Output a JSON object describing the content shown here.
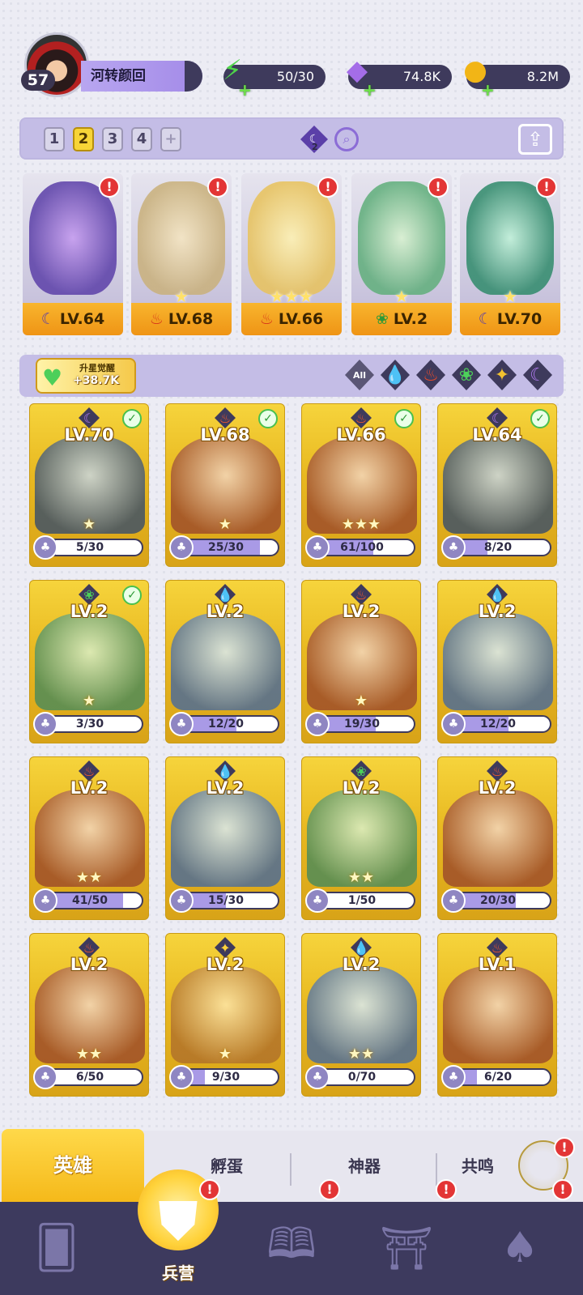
{
  "player": {
    "level": "57",
    "name": "河转颜回"
  },
  "resources": [
    {
      "name": "energy",
      "icon": "lightning-icon",
      "value": "50/30"
    },
    {
      "name": "gems",
      "icon": "gem-icon",
      "value": "74.8K"
    },
    {
      "name": "gold",
      "icon": "coin-icon",
      "value": "8.2M"
    }
  ],
  "team": {
    "pages": [
      "1",
      "2",
      "3",
      "4",
      "+"
    ],
    "active_page": "2",
    "badge_count": "2",
    "heroes": [
      {
        "level": "LV.64",
        "element": "dark",
        "stars": "",
        "alert": "!"
      },
      {
        "level": "LV.68",
        "element": "fire",
        "stars": "★",
        "alert": "!"
      },
      {
        "level": "LV.66",
        "element": "fire",
        "stars": "★★★",
        "alert": "!"
      },
      {
        "level": "LV.2",
        "element": "nature",
        "stars": "★",
        "alert": "!"
      },
      {
        "level": "LV.70",
        "element": "dark",
        "stars": "★",
        "alert": "!"
      }
    ]
  },
  "awaken": {
    "label": "升星觉醒",
    "value": "+38.7K"
  },
  "filters": [
    "All",
    "water",
    "fire",
    "nature",
    "light",
    "dark"
  ],
  "heroes": [
    {
      "level": "LV.70",
      "element": "dark",
      "stars": "★",
      "progress": "5/30",
      "fraction": 0.17,
      "checked": true
    },
    {
      "level": "LV.68",
      "element": "fire",
      "stars": "★",
      "progress": "25/30",
      "fraction": 0.83,
      "checked": true
    },
    {
      "level": "LV.66",
      "element": "fire",
      "stars": "★★★",
      "progress": "61/100",
      "fraction": 0.61,
      "checked": true
    },
    {
      "level": "LV.64",
      "element": "dark",
      "stars": "",
      "progress": "8/20",
      "fraction": 0.4,
      "checked": true
    },
    {
      "level": "LV.2",
      "element": "nature",
      "stars": "★",
      "progress": "3/30",
      "fraction": 0.1,
      "checked": true
    },
    {
      "level": "LV.2",
      "element": "water",
      "stars": "",
      "progress": "12/20",
      "fraction": 0.6,
      "checked": false
    },
    {
      "level": "LV.2",
      "element": "fire",
      "stars": "★",
      "progress": "19/30",
      "fraction": 0.63,
      "checked": false
    },
    {
      "level": "LV.2",
      "element": "water",
      "stars": "",
      "progress": "12/20",
      "fraction": 0.6,
      "checked": false
    },
    {
      "level": "LV.2",
      "element": "fire",
      "stars": "★★",
      "progress": "41/50",
      "fraction": 0.82,
      "checked": false
    },
    {
      "level": "LV.2",
      "element": "water",
      "stars": "",
      "progress": "15/30",
      "fraction": 0.5,
      "checked": false
    },
    {
      "level": "LV.2",
      "element": "nature",
      "stars": "★★",
      "progress": "1/50",
      "fraction": 0.02,
      "checked": false
    },
    {
      "level": "LV.2",
      "element": "fire",
      "stars": "",
      "progress": "20/30",
      "fraction": 0.67,
      "checked": false
    },
    {
      "level": "LV.2",
      "element": "fire",
      "stars": "★★",
      "progress": "6/50",
      "fraction": 0.12,
      "checked": false
    },
    {
      "level": "LV.2",
      "element": "light",
      "stars": "★",
      "progress": "9/30",
      "fraction": 0.3,
      "checked": false
    },
    {
      "level": "LV.2",
      "element": "water",
      "stars": "★★",
      "progress": "0/70",
      "fraction": 0.0,
      "checked": false
    },
    {
      "level": "LV.1",
      "element": "fire",
      "stars": "",
      "progress": "6/20",
      "fraction": 0.3,
      "checked": false
    }
  ],
  "tabs": [
    "英雄",
    "孵蛋",
    "神器",
    "共鸣"
  ],
  "nav": {
    "active_label": "兵营",
    "alert": "!"
  },
  "colors": {
    "accent": "#f5b91a",
    "panel": "#c4bde6",
    "dark": "#3e3a5c"
  }
}
